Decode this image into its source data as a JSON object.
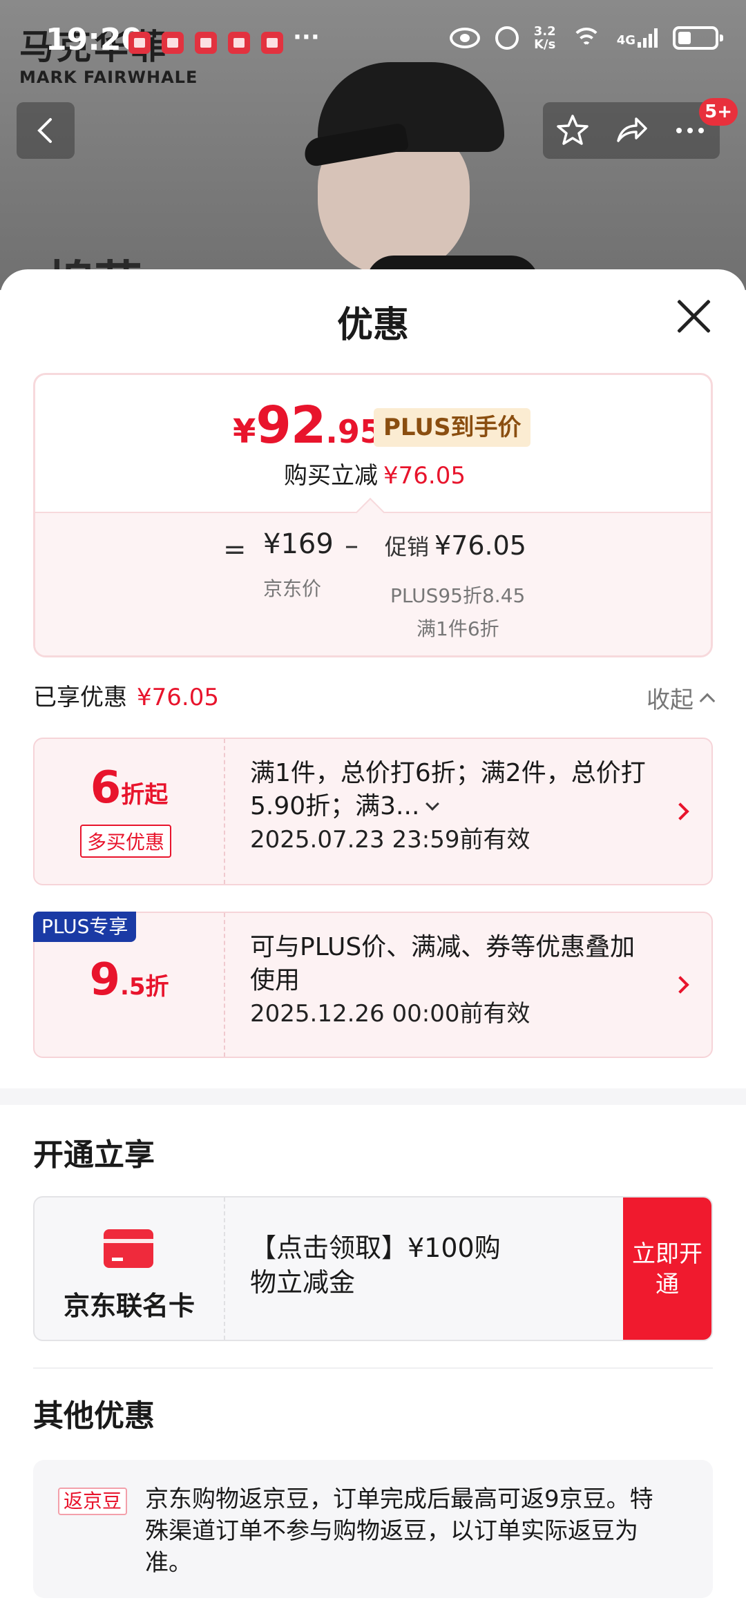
{
  "status_bar": {
    "time": "19:20",
    "more": "···",
    "speed_value": "3.2",
    "speed_unit": "K/s",
    "network": "4G"
  },
  "background_page": {
    "brand_cn": "马克华菲",
    "brand_en": "MARK FAIRWHALE",
    "partial_title": "棉苷",
    "cart_badge": "5+"
  },
  "sheet": {
    "title": "优惠",
    "price_card": {
      "currency": "¥",
      "price_int": "92",
      "price_dec": ".95",
      "plus_tag": "PLUS到手价",
      "buy_reduce_label": "购买立减",
      "buy_reduce_value": "¥76.05",
      "equals": "=",
      "jd_price": "¥169",
      "jd_price_label": "京东价",
      "minus": "–",
      "promo_label": "促销",
      "promo_value": "¥76.05",
      "promo_detail_1": "PLUS95折8.45",
      "promo_detail_2": "满1件6折"
    },
    "enjoyed_label": "已享优惠",
    "enjoyed_value": "¥76.05",
    "collapse_label": "收起",
    "coupons": [
      {
        "disc_num": "6",
        "disc_unit": "折起",
        "tag": "多买优惠",
        "text": "满1件，总价打6折；满2件，总价打5.90折；满3...",
        "valid": "2025.07.23 23:59前有效"
      },
      {
        "corner_tag": "PLUS专享",
        "disc_num": "9",
        "disc_unit": ".5折",
        "text": "可与PLUS价、满减、券等优惠叠加使用",
        "valid": "2025.12.26 00:00前有效"
      }
    ],
    "open_section": {
      "title": "开通立享",
      "card_name": "京东联名卡",
      "offer_text": "【点击领取】¥100购物立减金",
      "button": "立即开通"
    },
    "other_section": {
      "title": "其他优惠",
      "tag": "返京豆",
      "text": "京东购物返京豆，订单完成后最高可返9京豆。特殊渠道订单不参与购物返豆，以订单实际返豆为准。"
    }
  },
  "colors": {
    "accent_red": "#e8142c",
    "plus_blue": "#1a3aa5",
    "plus_tag_bg": "#fbecd2"
  },
  "icons": [
    "back-icon",
    "star-icon",
    "share-icon",
    "more-icon",
    "close-icon",
    "chevron-up-icon",
    "chevron-right-icon",
    "card-icon"
  ]
}
